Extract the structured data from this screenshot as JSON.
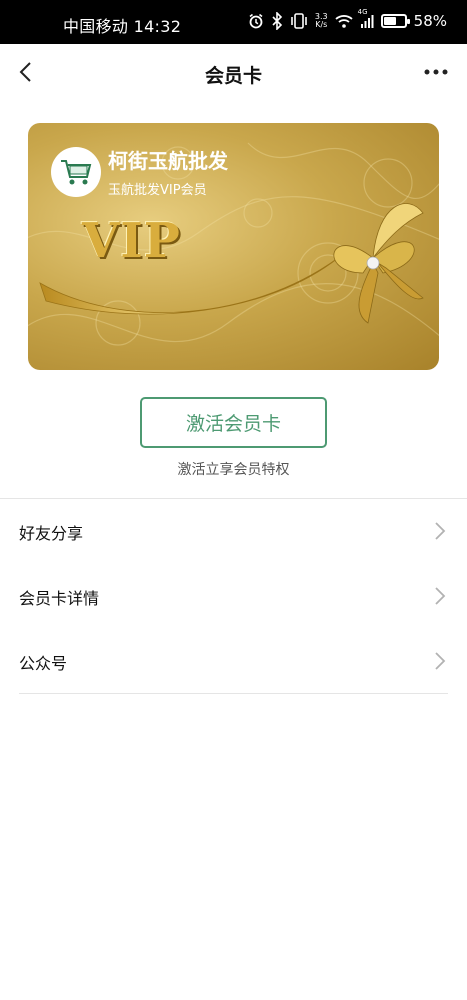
{
  "status_bar": {
    "carrier_time": "中国移动 14:32",
    "net_speed_value": "3.3",
    "net_speed_unit": "K/s",
    "signal_label": "4G",
    "battery_percent": "58%",
    "battery_level": 0.58
  },
  "nav": {
    "title": "会员卡"
  },
  "card": {
    "title": "柯街玉航批发",
    "subtitle": "玉航批发VIP会员",
    "vip_text": "VIP",
    "colors": {
      "gold_light": "#e7cd7f",
      "gold_mid": "#c9a74c",
      "gold_dark": "#a8822a"
    }
  },
  "activate": {
    "button_label": "激活会员卡",
    "hint": "激活立享会员特权",
    "accent_color": "#4d9a72"
  },
  "menu": {
    "items": [
      {
        "label": "好友分享",
        "icon": "chevron-right-icon"
      },
      {
        "label": "会员卡详情",
        "icon": "chevron-right-icon"
      },
      {
        "label": "公众号",
        "icon": "chevron-right-icon"
      }
    ]
  }
}
